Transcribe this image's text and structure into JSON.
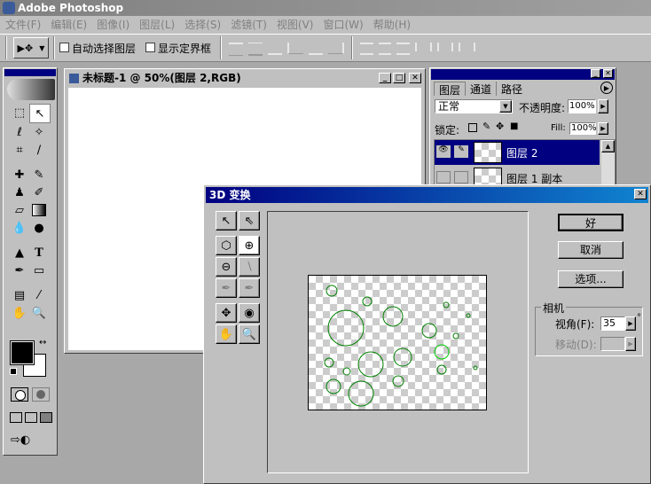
{
  "app": {
    "title": "Adobe Photoshop"
  },
  "menu": [
    "文件(F)",
    "编辑(E)",
    "图像(I)",
    "图层(L)",
    "选择(S)",
    "滤镜(T)",
    "视图(V)",
    "窗口(W)",
    "帮助(H)"
  ],
  "options_bar": {
    "auto_select": "自动选择图层",
    "show_bounds": "显示定界框"
  },
  "document": {
    "title": "未标题-1 @ 50%(图层 2,RGB)"
  },
  "layers_panel": {
    "tabs": [
      "图层",
      "通道",
      "路径"
    ],
    "blend_mode": "正常",
    "opacity_label": "不透明度:",
    "opacity_value": "100%",
    "lock_label": "锁定:",
    "fill_label": "Fill:",
    "fill_value": "100%",
    "layers": [
      "图层 2",
      "图层 1 副本"
    ]
  },
  "dialog": {
    "title": "3D 变换",
    "ok": "好",
    "cancel": "取消",
    "options": "选项...",
    "camera_group": "相机",
    "fov_label": "视角(F):",
    "fov_value": "35",
    "fov_unit": "°",
    "move_label": "移动(D):",
    "move_value": ""
  }
}
